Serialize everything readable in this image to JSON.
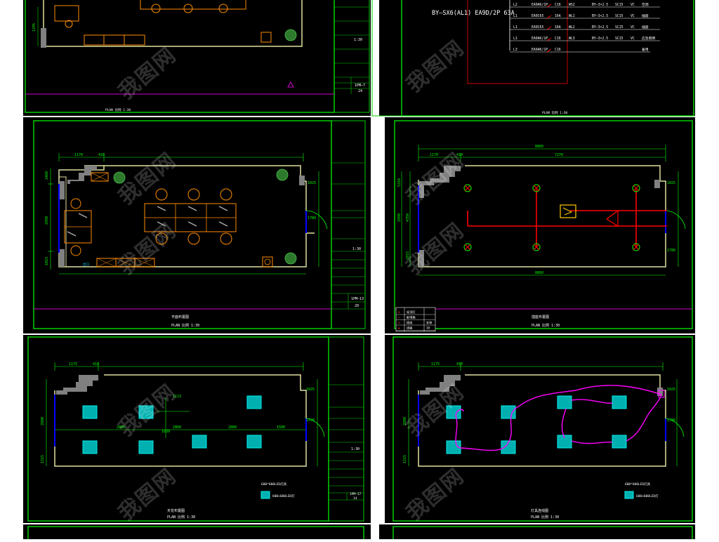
{
  "colors": {
    "background": "#ffffff",
    "sheet": "#000000",
    "frame": "#00d000",
    "room_wall": "#e0e0a0",
    "dimension": "#00ff00",
    "furniture": "#ff8c00",
    "circuit_red": "#ff0000",
    "circuit_magenta": "#ff00ff",
    "light_fixture": "#00cccc",
    "column": "#808080",
    "door": "#0000ff"
  },
  "icons": [
    "plant-icon",
    "desk-chair-icon",
    "ceiling-light-icon",
    "panel-light-icon",
    "distribution-box-icon"
  ],
  "sheets": {
    "top_left": {
      "caption": "PLAN 比例 1:30",
      "scale": "1:30",
      "dim_left": "1295",
      "sheet_no": "1PM—7",
      "page": "24"
    },
    "top_right": {
      "panel_label": "BY—SX6(AL1) EA9D/2P 63A",
      "circuits": [
        {
          "phase": "L2",
          "breaker": "EA9AK/1P",
          "rating": "C16",
          "line": "WS2",
          "cable": "BY—3×2.5",
          "conduit": "SC15",
          "method": "VC",
          "use": "空调"
        },
        {
          "phase": "L1",
          "breaker": "EA9C65",
          "rating": "16A",
          "line": "WL1",
          "cable": "BY—3×2.5",
          "conduit": "SC15",
          "method": "VC",
          "use": "插座"
        },
        {
          "phase": "L1",
          "breaker": "EA9C65",
          "rating": "16A",
          "line": "WL2",
          "cable": "BY—3×2.5",
          "conduit": "SC15",
          "method": "VC",
          "use": "插座"
        },
        {
          "phase": "L1",
          "breaker": "EA9AK/1P",
          "rating": "C16",
          "line": "WL3",
          "cable": "BY—3×2.5",
          "conduit": "SC15",
          "method": "VC",
          "use": "应急照明"
        },
        {
          "phase": "L3",
          "breaker": "EA9AK/1P",
          "rating": "C16",
          "line": "",
          "cable": "",
          "conduit": "",
          "method": "",
          "use": "备用"
        }
      ],
      "caption": "PLAN 比例 1:30"
    },
    "mid_left": {
      "title": "平面布置图",
      "caption": "PLAN 比例 1:30",
      "dims_top": [
        "1170",
        "410"
      ],
      "dims_left": [
        "2460",
        "2990",
        "1015"
      ],
      "dims_right": [
        "1025",
        "1780"
      ],
      "scale": "1:30",
      "sheet_no": "1PM—13",
      "page": "20",
      "sign_text": "出口"
    },
    "mid_right": {
      "title": "插座布置图",
      "caption": "PLAN 比例 1:30",
      "dims_top": [
        "1170",
        "410",
        "7270"
      ],
      "dim_top_overall": "8860",
      "dim_bottom": "8860",
      "dims_left": [
        "5310",
        "2990",
        "4350",
        "1015"
      ],
      "dims_right": [
        "1025",
        "1780"
      ],
      "legend_rows": [
        {
          "symbol": "⊗",
          "desc": "吸顶灯",
          "note": ""
        },
        {
          "symbol": "▭",
          "desc": "配电箱",
          "note": ""
        },
        {
          "symbol": "⊡",
          "desc": "插座",
          "note": "安装"
        },
        {
          "symbol": "▬",
          "desc": "线路",
          "note": "10"
        }
      ]
    },
    "bottom_left": {
      "title": "天花布置图",
      "caption": "PLAN 比例 1:30",
      "dims_top": [
        "1175",
        "410"
      ],
      "dims_left": [
        "2880",
        "1215"
      ],
      "dims_right": [
        "1025",
        "1780"
      ],
      "inner_dims": [
        "1113",
        "2800",
        "2800",
        "2800",
        "1500",
        "1630"
      ],
      "legend_text": "600*600LED灯具",
      "legend_item": "600×600LED灯",
      "scale": "1:30",
      "sheet_no": "1PM—17",
      "page": "14"
    },
    "bottom_right": {
      "title": "灯具连线图",
      "caption": "PLAN 比例 1:30",
      "dims_top": [
        "1175",
        "410"
      ],
      "dims_left": [
        "2880",
        "1215"
      ],
      "dims_right": [
        "1025",
        "1780"
      ],
      "legend_text": "600*600LED灯具",
      "legend_item": "600×600LED灯"
    }
  },
  "watermark": "我图网"
}
